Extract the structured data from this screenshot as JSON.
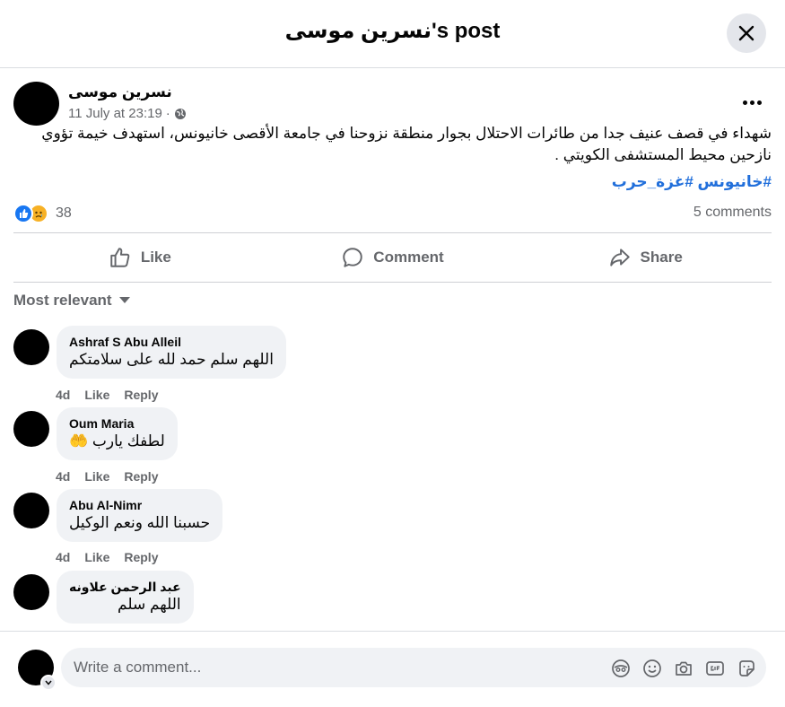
{
  "header": {
    "title": "نسرين موسى's post",
    "close_icon": "close-icon"
  },
  "post": {
    "author": "نسرين موسى",
    "timestamp": "11 July at 23:19",
    "separator": "·",
    "privacy_icon": "globe-icon",
    "text": "شهداء في قصف عنيف جدا من طائرات الاحتلال بجوار  منطقة نزوحنا في جامعة الأقصى خانيونس، استهدف خيمة تؤوي نازحين محيط المستشفى الكويتي .",
    "hashtags": "#خانيونس #غزة_حرب",
    "reaction_count": "38",
    "comments_count": "5 comments"
  },
  "actions": {
    "like": "Like",
    "comment": "Comment",
    "share": "Share"
  },
  "sort_label": "Most relevant",
  "comments": [
    {
      "author": "Ashraf S Abu Alleil",
      "text": "اللهم سلم حمد لله على سلامتكم",
      "time": "4d",
      "like": "Like",
      "reply": "Reply"
    },
    {
      "author": "Oum Maria",
      "text": "لطفك يارب",
      "emoji": "🤲",
      "time": "4d",
      "like": "Like",
      "reply": "Reply"
    },
    {
      "author": "Abu Al-Nimr",
      "text": "حسبنا الله ونعم الوكيل",
      "time": "4d",
      "like": "Like",
      "reply": "Reply"
    },
    {
      "author": "عبد الرحمن علاونه",
      "text": "اللهم سلم"
    }
  ],
  "composer": {
    "placeholder": "Write a comment..."
  },
  "colors": {
    "accent": "#1877f2",
    "hashtag": "#216fdb",
    "muted": "#65676b",
    "bubble": "#f0f2f5"
  }
}
